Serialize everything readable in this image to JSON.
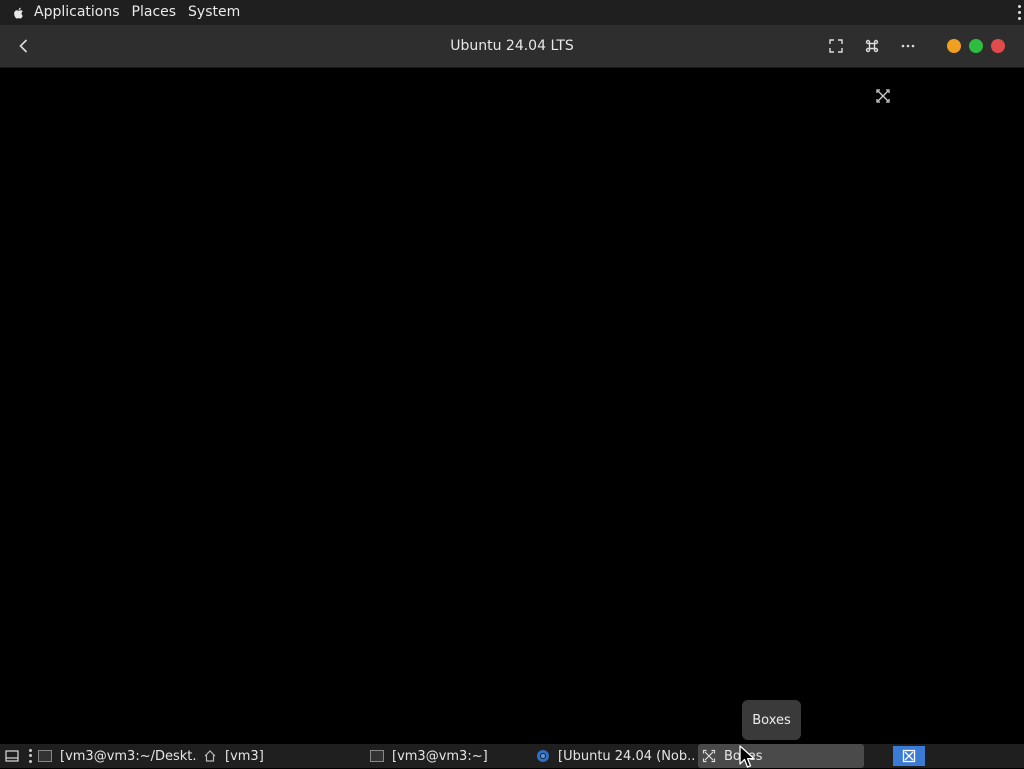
{
  "top_panel": {
    "menus": [
      "Applications",
      "Places",
      "System"
    ]
  },
  "window": {
    "title": "Ubuntu 24.04 LTS"
  },
  "tooltip": {
    "text": "Boxes"
  },
  "taskbar": {
    "tasks": [
      {
        "label": "[vm3@vm3:~/Deskt..."
      },
      {
        "label": "[vm3]"
      },
      {
        "label": "[vm3@vm3:~]"
      },
      {
        "label": "[Ubuntu 24.04 (Nob..."
      },
      {
        "label": "Boxes"
      }
    ]
  },
  "colors": {
    "panel_bg": "#1f1f1f",
    "headerbar_bg": "#2e2e2e",
    "minimize": "#f0a020",
    "maximize": "#2ebd3e",
    "close": "#e24b4b",
    "tray_accent": "#3b7bd6"
  },
  "icons": {
    "panel_logo": "apple-logo-icon",
    "back": "chevron-left-icon",
    "fullscreen": "fullscreen-icon",
    "keys": "command-key-icon",
    "more": "ellipsis-icon",
    "ungrab": "boxes-ungrab-icon"
  }
}
